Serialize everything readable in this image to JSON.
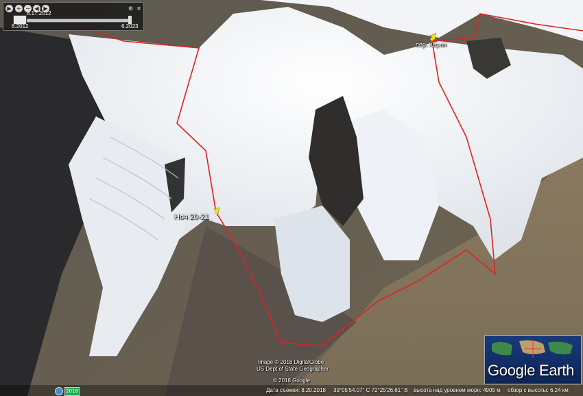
{
  "map": {
    "markers": [
      {
        "label": "Ноч 20-21"
      },
      {
        "label": "пер. Каран"
      }
    ],
    "attribution": {
      "line1": "Image © 2018 DigitalGlobe",
      "line2": "US Dept of State Geographer",
      "line3": "© 2018 Google"
    },
    "route_color": "#e02020",
    "marker_color": "#f5e400"
  },
  "time_slider": {
    "current_date": "8.17.2012",
    "start_label": "6.2012",
    "end_label": "6.2023"
  },
  "status_bar": {
    "date_text": "Дата съемки: 8.20.2018",
    "coords_text": "39°05'54.07\" С  72°25'26.61\" В",
    "elevation_text": "высота над уровнем моря: 4905 м",
    "eye_alt_text": "обзор с высоты: 6.24 км"
  },
  "logo": {
    "text": "Google Earth"
  },
  "taskbar": {
    "icon_text": "2018"
  }
}
